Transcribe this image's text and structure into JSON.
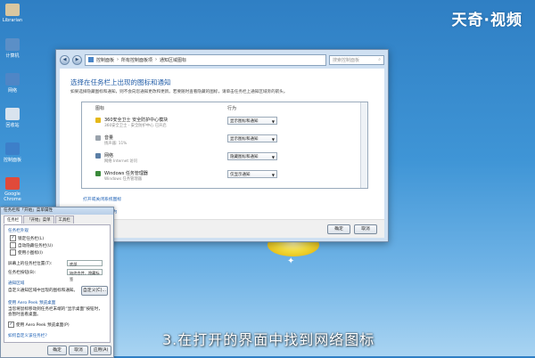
{
  "watermark": "天奇·视频",
  "desktop_icons": [
    {
      "label": "Librarian",
      "color": "#d9c7a0"
    },
    {
      "label": "计算机",
      "color": "#5b8fc7"
    },
    {
      "label": "网络",
      "color": "#4f86c6"
    },
    {
      "label": "回收站",
      "color": "#d9e3ee"
    },
    {
      "label": "控制面板",
      "color": "#3d7fc9"
    },
    {
      "label": "Google Chrome",
      "color": "#e04a3a"
    }
  ],
  "main_window": {
    "breadcrumb": [
      "控制面板",
      "所有控制面板项",
      "通知区域图标"
    ],
    "search_placeholder": "搜索控制面板",
    "heading": "选择在任务栏上出现的图标和通知",
    "description": "如果选择隐藏图标和通知，则不会向您通知更改和更新。若要随时查看隐藏的图标，请单击任务栏上通知区域旁的箭头。",
    "columns": {
      "icon": "图标",
      "behavior": "行为"
    },
    "rows": [
      {
        "name": "360安全卫士 安全防护中心模块",
        "sub": "360安全卫士 - 安全防护中心 已开启",
        "behavior": "显示图标和通知",
        "icon_color": "#e5b81a"
      },
      {
        "name": "音量",
        "sub": "扬声器: 11%",
        "behavior": "显示图标和通知",
        "icon_color": "#9aa3ad"
      },
      {
        "name": "网络",
        "sub": "网络 Internet 访问",
        "behavior": "隐藏图标和通知",
        "icon_color": "#5b7fa6"
      },
      {
        "name": "Windows 任务管理器",
        "sub": "Windows 任务管理器",
        "behavior": "仅显示通知",
        "icon_color": "#3b8a3b"
      }
    ],
    "links": [
      "打开或关闭系统图标",
      "还原默认图标行为"
    ],
    "checkbox_label": "始终在任务栏上显示所有图标和通知(A)",
    "ok": "确定",
    "cancel": "取消"
  },
  "taskbar_dialog": {
    "title": "任务栏和「开始」菜单属性",
    "tabs": [
      "任务栏",
      "「开始」菜单",
      "工具栏"
    ],
    "section": "任务栏外观",
    "options": [
      {
        "label": "锁定任务栏(L)",
        "checked": true
      },
      {
        "label": "自动隐藏任务栏(U)",
        "checked": false
      },
      {
        "label": "使用小图标(I)",
        "checked": false
      }
    ],
    "position_label": "屏幕上的任务栏位置(T):",
    "position_value": "底部",
    "buttons_label": "任务栏按钮(B):",
    "buttons_value": "始终合并、隐藏标签",
    "notify_section": "通知区域",
    "notify_text": "自定义通知区域中出现的图标和通知。",
    "customize": "自定义(C)...",
    "aero_section": "使用 Aero Peek 预览桌面",
    "aero_text": "当您将鼠标移动到任务栏末端的“显示桌面”按钮时，会暂时查看桌面。",
    "aero_check": "使用 Aero Peek 预览桌面(P)",
    "help_link": "如何自定义该任务栏?",
    "ok": "确定",
    "cancel": "取消",
    "apply": "应用(A)"
  },
  "caption": "3.在打开的界面中找到网络图标"
}
